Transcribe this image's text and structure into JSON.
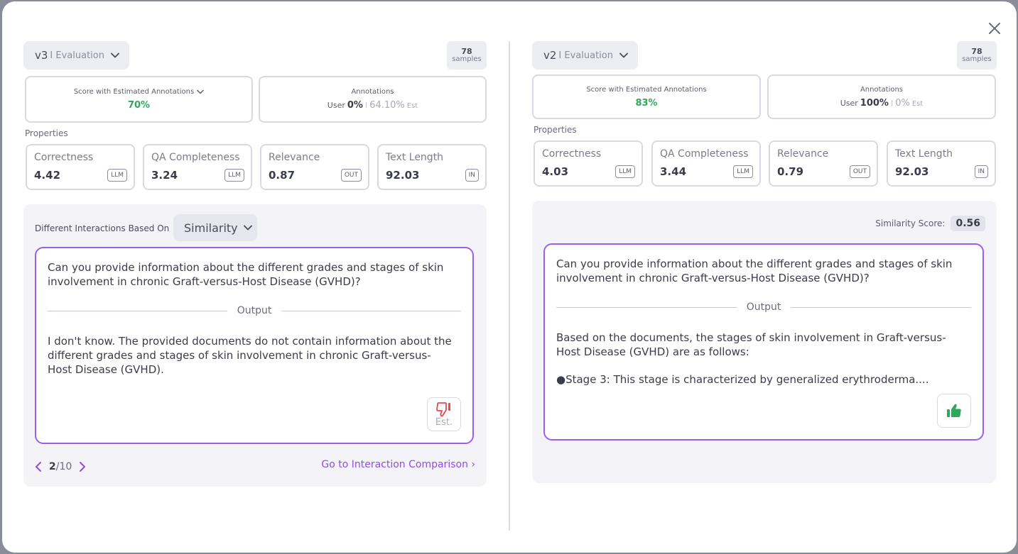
{
  "close_icon": "close-icon",
  "left": {
    "version": "v3",
    "version_sep": "I Evaluation",
    "samples_count": "78",
    "samples_label": "samples",
    "score_title": "Score with Estimated Annotations",
    "score_value": "70%",
    "annotations_title": "Annotations",
    "annotations_user_label": "User",
    "annotations_user_value": "0%",
    "annotations_sep": "I",
    "annotations_est_value": "64.10%",
    "annotations_est_label": "Est",
    "properties_label": "Properties",
    "properties": [
      {
        "name": "Correctness",
        "value": "4.42",
        "tag": "LLM"
      },
      {
        "name": "QA Completeness",
        "value": "3.24",
        "tag": "LLM"
      },
      {
        "name": "Relevance",
        "value": "0.87",
        "tag": "OUT"
      },
      {
        "name": "Text Length",
        "value": "92.03",
        "tag": "IN"
      }
    ],
    "diff_label": "Different Interactions Based On",
    "diff_select": "Similarity",
    "input_text": "Can you provide information about the different grades and stages of skin involvement in chronic Graft-versus-Host Disease (GVHD)?",
    "output_label": "Output",
    "output_text": "I don't know. The provided documents do not contain information about the different grades and stages of skin involvement in chronic Graft-versus-Host Disease (GVHD).",
    "feedback_icon": "thumbs-down-icon",
    "feedback_est": "Est.",
    "page_current": "2",
    "page_total": "/10",
    "goto_label": "Go to Interaction Comparison ›"
  },
  "right": {
    "version": "v2",
    "version_sep": "I Evaluation",
    "samples_count": "78",
    "samples_label": "samples",
    "score_title": "Score with Estimated Annotations",
    "score_value": "83%",
    "annotations_title": "Annotations",
    "annotations_user_label": "User",
    "annotations_user_value": "100%",
    "annotations_sep": "I",
    "annotations_est_value": "0%",
    "annotations_est_label": "Est",
    "properties_label": "Properties",
    "properties": [
      {
        "name": "Correctness",
        "value": "4.03",
        "tag": "LLM"
      },
      {
        "name": "QA Completeness",
        "value": "3.44",
        "tag": "LLM"
      },
      {
        "name": "Relevance",
        "value": "0.79",
        "tag": "OUT"
      },
      {
        "name": "Text Length",
        "value": "92.03",
        "tag": "IN"
      }
    ],
    "similarity_label": "Similarity Score:",
    "similarity_value": "0.56",
    "input_text": "Can you provide information about the different grades and stages of skin involvement in chronic Graft-versus-Host Disease (GVHD)?",
    "output_label": "Output",
    "output_text_1": "Based on the documents, the stages of skin involvement in Graft-versus-Host Disease (GVHD) are as follows:",
    "output_text_2": "●Stage 3: This stage is characterized by generalized erythroderma....",
    "feedback_icon": "thumbs-up-icon"
  },
  "colors": {
    "accent_purple": "#9a5ff0",
    "score_green": "#2fa75c",
    "thumbs_down_red": "#e5484d",
    "thumbs_up_green": "#2fa75c"
  }
}
